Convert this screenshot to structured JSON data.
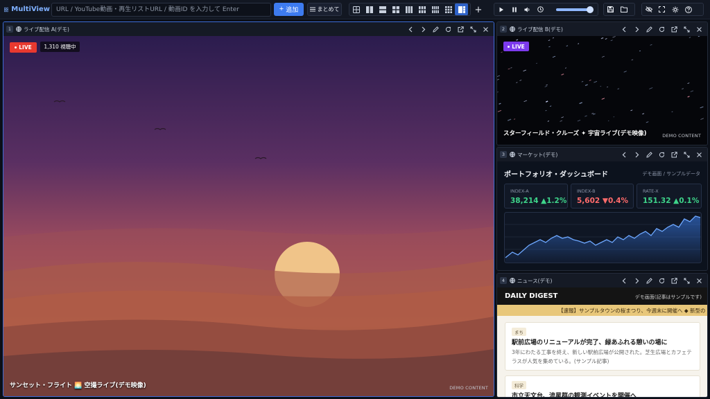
{
  "app": {
    "name": "MultiView"
  },
  "toolbar": {
    "url_placeholder": "URL / YouTube動画・再生リストURL / 動画ID を入力して Enter",
    "add_label": "追加",
    "batch_label": "まとめて",
    "volume": 0.9,
    "active_layout": "focus-layout"
  },
  "panels": [
    {
      "index": "1",
      "title": "ライブ配信 A(デモ)",
      "live_label": "LIVE",
      "viewers": "1,310 視聴中",
      "caption": "サンセット・フライト 🌅 空撮ライブ(デモ映像)",
      "demo": "DEMO CONTENT"
    },
    {
      "index": "2",
      "title": "ライブ配信 B(デモ)",
      "live_label": "LIVE",
      "caption": "スターフィールド・クルーズ ✦ 宇宙ライブ(デモ映像)",
      "demo": "DEMO CONTENT"
    },
    {
      "index": "3",
      "title": "マーケット(デモ)",
      "dashboard_title": "ポートフォリオ・ダッシュボード",
      "dashboard_note": "デモ画面 / サンプルデータ",
      "cards": [
        {
          "label": "INDEX-A",
          "value": "38,214 ▲1.2%",
          "color": "#3ed48a"
        },
        {
          "label": "INDEX-B",
          "value": "5,602 ▼0.4%",
          "color": "#ff6b6b"
        },
        {
          "label": "RATE-X",
          "value": "151.32 ▲0.1%",
          "color": "#3ed48a"
        }
      ]
    },
    {
      "index": "4",
      "title": "ニュース(デモ)",
      "masthead": "DAILY DIGEST",
      "masthead_note": "デモ画面(記事はサンプルです)",
      "ticker": "【速報】サンプルタウンの桜まつり、今週末に開催へ ◆ 新型の",
      "articles": [
        {
          "tag": "まち",
          "title": "駅前広場のリニューアルが完了、緑あふれる憩いの場に",
          "body": "3年にわたる工事を終え、新しい駅前広場が公開された。芝生広場とカフェテラスが人気を集めている。(サンプル記事)"
        },
        {
          "tag": "科学",
          "title": "市立天文台、流星群の観測イベントを開催へ",
          "body": ""
        }
      ]
    }
  ],
  "colors": {
    "accent": "#3d7bf0",
    "live": "#e8392f",
    "live_b": "#7c3aed",
    "up": "#3ed48a",
    "down": "#ff6b6b"
  }
}
